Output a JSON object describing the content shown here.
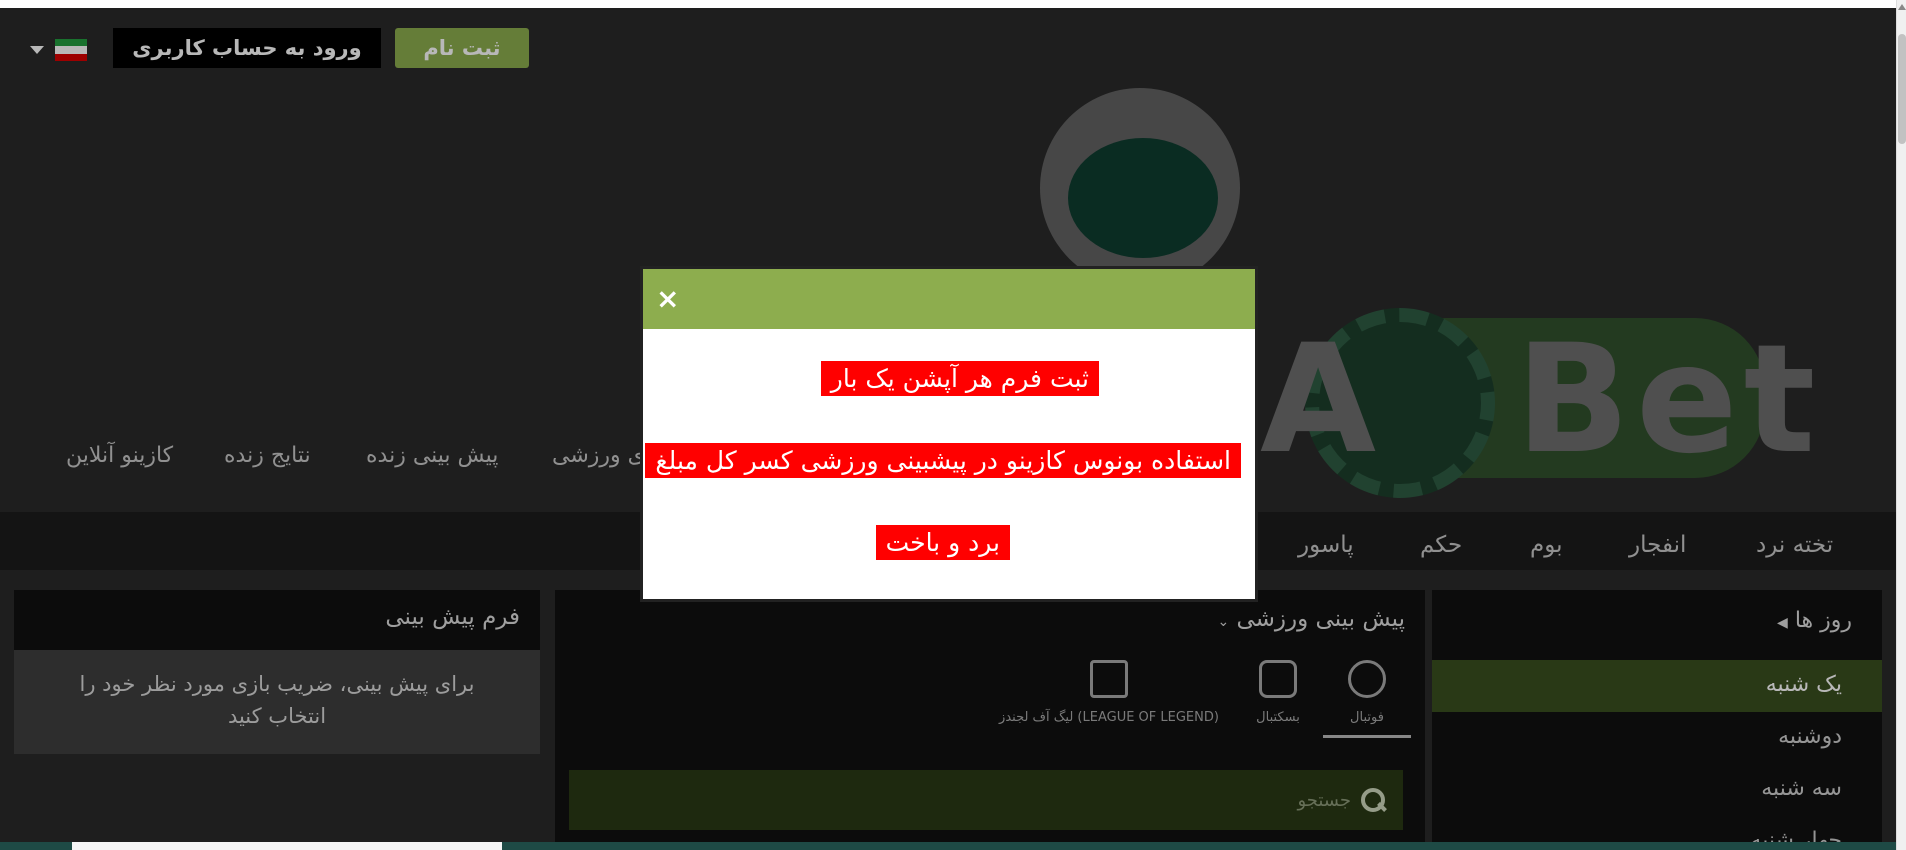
{
  "header": {
    "register_label": "ثبت نام",
    "login_label": "ورود به حساب کاربری",
    "flag_colors": [
      "#239f40",
      "#ffffff",
      "#da0000"
    ],
    "logo_text": "Bet"
  },
  "main_nav": {
    "items": [
      {
        "label": "کازینو آنلاین"
      },
      {
        "label": "نتایج زنده"
      },
      {
        "label": "پیش بینی زنده"
      },
      {
        "label": "ی ورزشی"
      }
    ]
  },
  "games_nav": {
    "items": [
      {
        "label": "تخته نرد"
      },
      {
        "label": "انفجار"
      },
      {
        "label": "بوم"
      },
      {
        "label": "حکم"
      },
      {
        "label": "پاسور"
      }
    ]
  },
  "bet_form": {
    "title": "فرم پیش بینی",
    "body": "برای پیش بینی، ضریب بازی مورد نظر خود را انتخاب کنید"
  },
  "sports": {
    "title": "پیش بینی ورزشی",
    "tabs": [
      {
        "label": "فوتبال",
        "icon": "football-icon"
      },
      {
        "label": "بسکتبال",
        "icon": "basketball-icon"
      },
      {
        "label": "لیگ آف لجندز (LEAGUE OF LEGEND)",
        "icon": "lol-icon"
      }
    ],
    "search_placeholder": "جستجو"
  },
  "days": {
    "title": "روز ها",
    "items": [
      {
        "label": "یک شنبه",
        "selected": true
      },
      {
        "label": "دوشنبه"
      },
      {
        "label": "سه شنبه"
      },
      {
        "label": "چهار شنبه"
      }
    ]
  },
  "modal": {
    "close_icon": "×",
    "lines": [
      "ثبت فرم هر آپشن یک بار",
      "استفاده بونوس کازینو در پیشبینی ورزشی کسر کل مبلغ",
      "برد و باخت"
    ],
    "accent": "#8dad4e",
    "highlight": "#ff0000"
  }
}
